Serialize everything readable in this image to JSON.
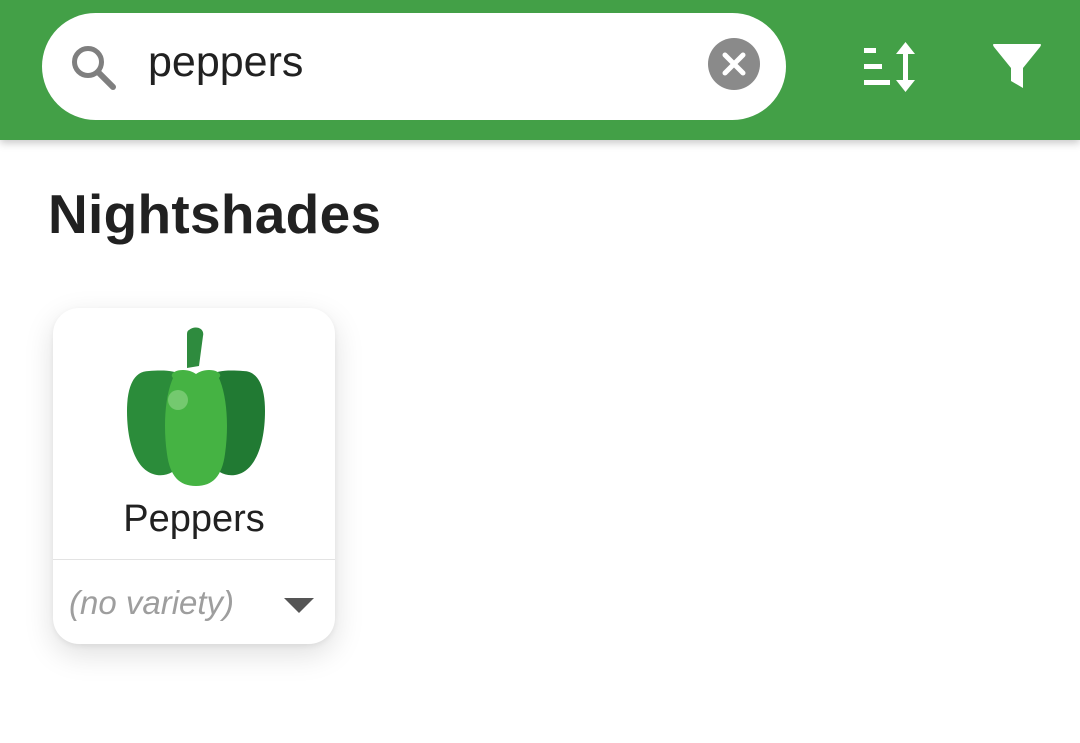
{
  "colors": {
    "app_bar": "#43a047",
    "text_primary": "#212121",
    "placeholder_grey": "#9e9e9e",
    "icon_grey": "#8a8a8a"
  },
  "search": {
    "value": "peppers",
    "icon": "search-icon",
    "clear_icon": "close-circle-icon"
  },
  "toolbar": {
    "sort_icon": "sort-icon",
    "filter_icon": "filter-icon"
  },
  "section": {
    "title": "Nightshades"
  },
  "cards": [
    {
      "title": "Peppers",
      "image_icon": "bell-pepper-icon",
      "variety": "(no variety)"
    }
  ]
}
